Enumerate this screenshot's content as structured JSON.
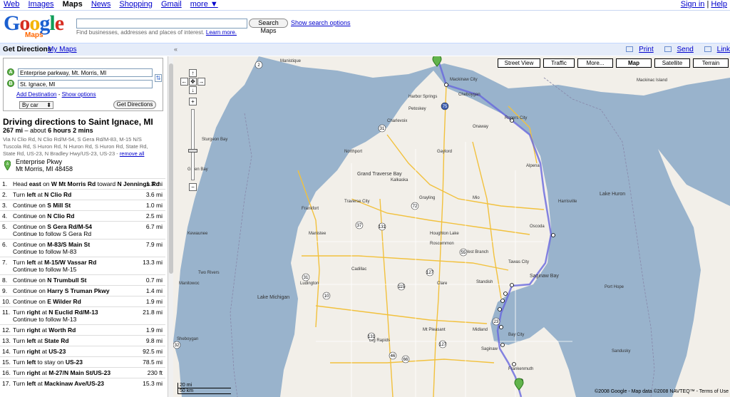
{
  "gbar": {
    "links": [
      "Web",
      "Images",
      "Maps",
      "News",
      "Shopping",
      "Gmail",
      "more ▼"
    ],
    "active": "Maps",
    "sign_in": "Sign in",
    "sep": "|",
    "help": "Help"
  },
  "header": {
    "logo_text": "Google",
    "logo_sub": "Maps",
    "search_value": "",
    "search_button": "Search Maps",
    "search_options": "Show search options",
    "hint": "Find businesses, addresses and places of interest.",
    "learn_more": "Learn more."
  },
  "subbar": {
    "get_directions": "Get Directions",
    "my_maps": "My Maps",
    "collapse": "«",
    "print": "Print",
    "send": "Send",
    "link": "Link"
  },
  "directions_form": {
    "marker_a": "A",
    "marker_b": "B",
    "from": "Enterprise parkway, Mt. Morris, MI",
    "to": "St. Ignace, MI",
    "add_destination": "Add Destination",
    "dash": " - ",
    "show_options": "Show options",
    "mode": "By car",
    "submit": "Get Directions"
  },
  "route": {
    "title": "Driving directions to Saint Ignace, MI",
    "distance": "267 mi",
    "about": " – about ",
    "duration": "6 hours 2 mins",
    "via": "Via N Clio Rd, N Clio Rd/M-54, S Gera Rd/M-83, M-15 N/S Tuscola Rd, S Huron Rd, N Huron Rd, S Huron Rd, State Rd, State Rd, US-23, N Bradley Hwy/US-23, US-23 - ",
    "remove_all": "remove all",
    "start_name": "Enterprise Pkwy",
    "start_city": "Mt Morris, MI 48458"
  },
  "steps": [
    {
      "num": "1.",
      "pre": "Head ",
      "b1": "east",
      "mid": " on ",
      "b2": "W Mt Morris Rd",
      "post": " toward ",
      "b3": "N Jennings Rd",
      "note": "",
      "dist": "1.3 mi"
    },
    {
      "num": "2.",
      "pre": "Turn ",
      "b1": "left",
      "mid": " at ",
      "b2": "N Clio Rd",
      "post": "",
      "b3": "",
      "note": "",
      "dist": "3.6 mi"
    },
    {
      "num": "3.",
      "pre": "Continue on ",
      "b1": "",
      "mid": "",
      "b2": "S Mill St",
      "post": "",
      "b3": "",
      "note": "",
      "dist": "1.0 mi"
    },
    {
      "num": "4.",
      "pre": "Continue on ",
      "b1": "",
      "mid": "",
      "b2": "N Clio Rd",
      "post": "",
      "b3": "",
      "note": "",
      "dist": "2.5 mi"
    },
    {
      "num": "5.",
      "pre": "Continue on ",
      "b1": "",
      "mid": "",
      "b2": "S Gera Rd/M-54",
      "post": "",
      "b3": "",
      "note": "Continue to follow S Gera Rd",
      "dist": "6.7 mi"
    },
    {
      "num": "6.",
      "pre": "Continue on ",
      "b1": "",
      "mid": "",
      "b2": "M-83/S Main St",
      "post": "",
      "b3": "",
      "note": "Continue to follow M-83",
      "dist": "7.9 mi"
    },
    {
      "num": "7.",
      "pre": "Turn ",
      "b1": "left",
      "mid": " at ",
      "b2": "M-15/W Vassar Rd",
      "post": "",
      "b3": "",
      "note": "Continue to follow M-15",
      "dist": "13.3 mi"
    },
    {
      "num": "8.",
      "pre": "Continue on ",
      "b1": "",
      "mid": "",
      "b2": "N Trumbull St",
      "post": "",
      "b3": "",
      "note": "",
      "dist": "0.7 mi"
    },
    {
      "num": "9.",
      "pre": "Continue on ",
      "b1": "",
      "mid": "",
      "b2": "Harry S Truman Pkwy",
      "post": "",
      "b3": "",
      "note": "",
      "dist": "1.4 mi"
    },
    {
      "num": "10.",
      "pre": "Continue on ",
      "b1": "",
      "mid": "",
      "b2": "E Wilder Rd",
      "post": "",
      "b3": "",
      "note": "",
      "dist": "1.9 mi"
    },
    {
      "num": "11.",
      "pre": "Turn ",
      "b1": "right",
      "mid": " at ",
      "b2": "N Euclid Rd/M-13",
      "post": "",
      "b3": "",
      "note": "Continue to follow M-13",
      "dist": "21.8 mi"
    },
    {
      "num": "12.",
      "pre": "Turn ",
      "b1": "right",
      "mid": " at ",
      "b2": "Worth Rd",
      "post": "",
      "b3": "",
      "note": "",
      "dist": "1.9 mi"
    },
    {
      "num": "13.",
      "pre": "Turn ",
      "b1": "left",
      "mid": " at ",
      "b2": "State Rd",
      "post": "",
      "b3": "",
      "note": "",
      "dist": "9.8 mi"
    },
    {
      "num": "14.",
      "pre": "Turn ",
      "b1": "right",
      "mid": " at ",
      "b2": "US-23",
      "post": "",
      "b3": "",
      "note": "",
      "dist": "92.5 mi"
    },
    {
      "num": "15.",
      "pre": "Turn ",
      "b1": "left",
      "mid": " to stay on ",
      "b2": "US-23",
      "post": "",
      "b3": "",
      "note": "",
      "dist": "78.5 mi"
    },
    {
      "num": "16.",
      "pre": "Turn ",
      "b1": "right",
      "mid": " at ",
      "b2": "M-27/N Main St/US-23",
      "post": "",
      "b3": "",
      "note": "",
      "dist": "230 ft"
    },
    {
      "num": "17.",
      "pre": "Turn ",
      "b1": "left",
      "mid": " at ",
      "b2": "Mackinaw Ave/US-23",
      "post": "",
      "b3": "",
      "note": "",
      "dist": "15.3 mi"
    }
  ],
  "map": {
    "types": [
      "Street View",
      "Traffic",
      "More...",
      "Map",
      "Satellite",
      "Terrain"
    ],
    "active_type": "Map",
    "zoom_in": "+",
    "zoom_out": "−",
    "pan_up": "↑",
    "pan_left": "←",
    "pan_right": "→",
    "pan_down": "↓",
    "pan_center": "✥",
    "scale_mi": "20 mi",
    "scale_km": "50 km",
    "copyright": "©2008 Google - Map data ©2008 NAVTEQ™ - Terms of Use",
    "lakes": [
      "Lake Huron",
      "Lake Michigan",
      "Saginaw Bay",
      "Grand Traverse Bay"
    ],
    "cities": [
      "Mackinaw City",
      "Harbor Springs",
      "Petoskey",
      "Charlevoix",
      "Cheboygan",
      "Onaway",
      "Rogers City",
      "Alpena",
      "Gaylord",
      "Traverse City",
      "Northport",
      "Grayling",
      "Cadillac",
      "Ludington",
      "Manistee",
      "Houghton Lake",
      "Oscoda",
      "Tawas City",
      "Standish",
      "Midland",
      "Saginaw",
      "Bay City",
      "Mt Pleasant",
      "Big Rapids",
      "Frankenmuth",
      "Frankfort",
      "Green Bay",
      "Manitowoc",
      "Two Rivers",
      "Sheboygan",
      "Port Hope",
      "Sandusky",
      "Harrisville",
      "Mio",
      "West Branch",
      "Roscommon",
      "Clare",
      "Kalkaska",
      "Manistique",
      "Mackinac Island",
      "Kewaunee",
      "Sturgeon Bay"
    ],
    "shields": [
      "2",
      "31",
      "75",
      "72",
      "37",
      "131",
      "55",
      "127",
      "115",
      "10",
      "23",
      "46",
      "66",
      "131",
      "127",
      "31",
      "32"
    ]
  }
}
